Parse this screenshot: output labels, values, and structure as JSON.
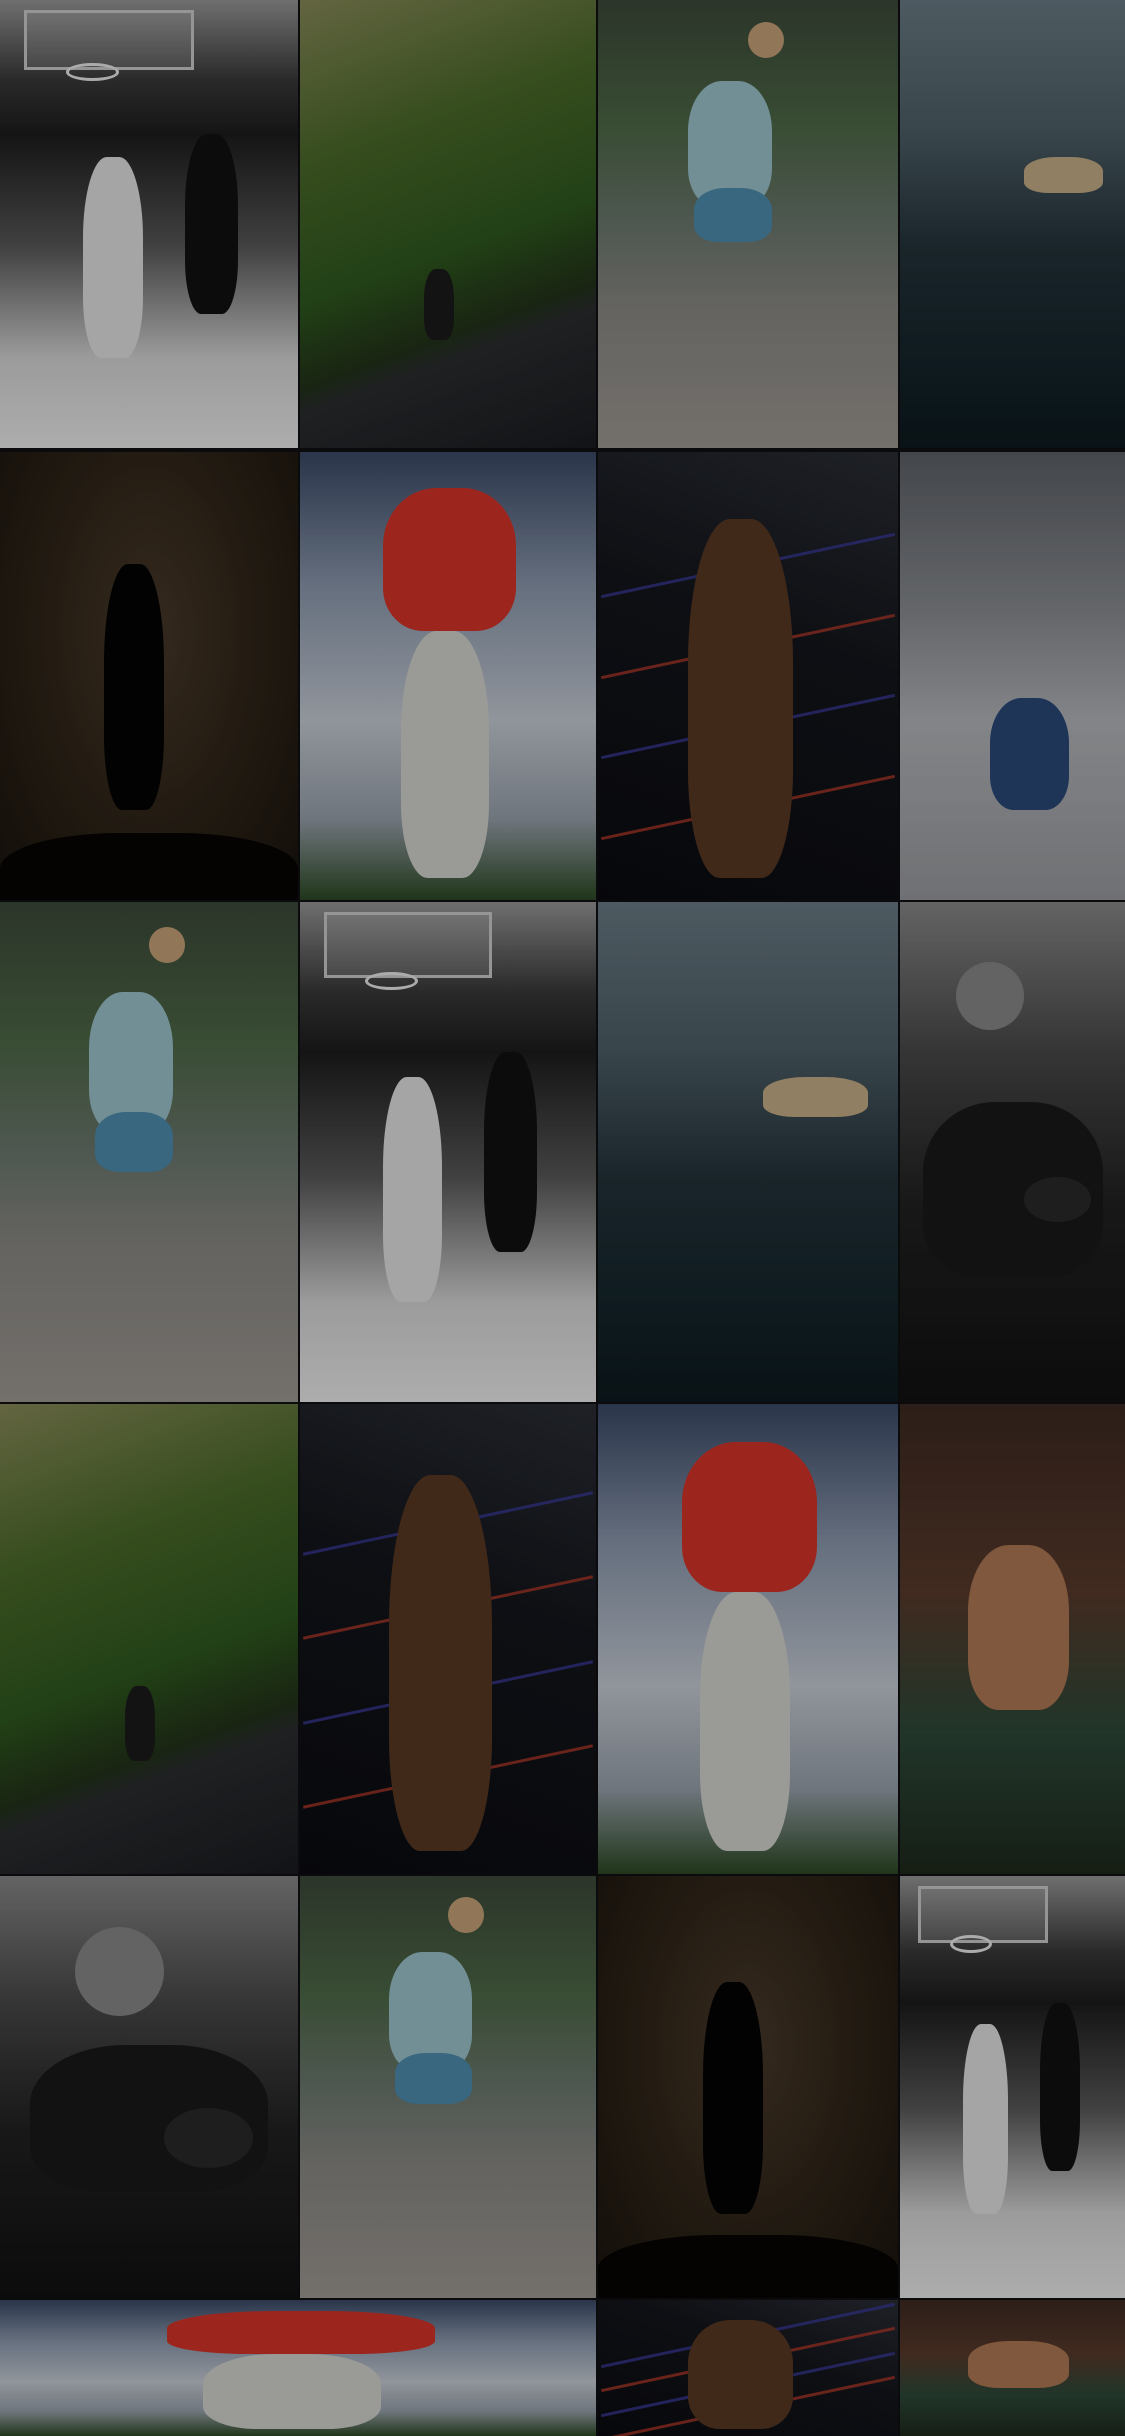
{
  "gallery": {
    "tiles": [
      {
        "scene": "basketball-bw",
        "alt": ""
      },
      {
        "scene": "cyclist-cliff-road",
        "alt": ""
      },
      {
        "scene": "runner-stretch",
        "alt": ""
      },
      {
        "scene": "surfer-wave",
        "alt": ""
      },
      {
        "scene": "dancer-silhouette",
        "alt": ""
      },
      {
        "scene": "golfer-swing",
        "alt": ""
      },
      {
        "scene": "boxer-ring",
        "alt": ""
      },
      {
        "scene": "snowboarder",
        "alt": ""
      },
      {
        "scene": "runner-stretch",
        "alt": ""
      },
      {
        "scene": "basketball-bw",
        "alt": ""
      },
      {
        "scene": "surfer-wave",
        "alt": ""
      },
      {
        "scene": "boxing-coach-bw",
        "alt": ""
      },
      {
        "scene": "cyclist-cliff-road",
        "alt": ""
      },
      {
        "scene": "boxer-ring",
        "alt": ""
      },
      {
        "scene": "golfer-swing",
        "alt": ""
      },
      {
        "scene": "rock-climber",
        "alt": ""
      },
      {
        "scene": "boxing-coach-bw",
        "alt": ""
      },
      {
        "scene": "runner-stretch",
        "alt": ""
      },
      {
        "scene": "dancer-silhouette",
        "alt": ""
      },
      {
        "scene": "basketball-bw",
        "alt": ""
      },
      {
        "scene": "golfer-swing",
        "alt": ""
      },
      {
        "scene": "boxer-ring",
        "alt": ""
      },
      {
        "scene": "rock-climber",
        "alt": ""
      }
    ]
  }
}
